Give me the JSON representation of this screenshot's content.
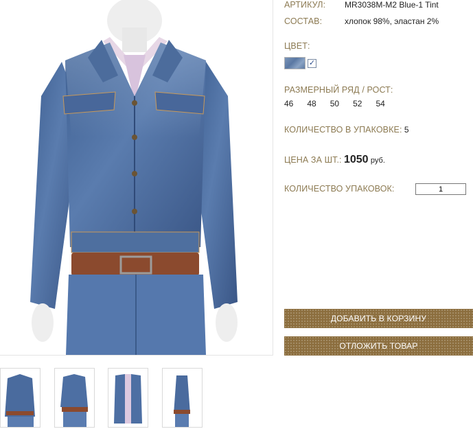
{
  "product": {
    "article_label": "АРТИКУЛ:",
    "article_value": "MR3038M-M2 Blue-1 Tint",
    "composition_label": "СОСТАВ:",
    "composition_value": "хлопок 98%, эластан 2%",
    "color_label": "ЦВЕТ:",
    "color_checked": "✓",
    "sizes_label": "РАЗМЕРНЫЙ РЯД / РОСТ:",
    "sizes": [
      "46",
      "48",
      "50",
      "52",
      "54"
    ],
    "pack_qty_label": "КОЛИЧЕСТВО В УПАКОВКЕ:",
    "pack_qty_value": "5",
    "price_label": "ЦЕНА ЗА ШТ.:",
    "price_value": "1050",
    "price_currency": "руб.",
    "packs_label": "КОЛИЧЕСТВО УПАКОВОК:",
    "packs_value": "1"
  },
  "buttons": {
    "add_to_cart": "ДОБАВИТЬ В КОРЗИНУ",
    "postpone": "ОТЛОЖИТЬ ТОВАР"
  },
  "colors": {
    "label": "#8c7a52",
    "button": "#8c6e3e",
    "denim": "#4f6f9f"
  },
  "icons": {
    "main_photo": "denim-jacket-photo",
    "thumbnails": [
      "front-view-thumb",
      "front-belt-view-thumb",
      "open-jacket-thumb",
      "side-view-thumb"
    ]
  }
}
